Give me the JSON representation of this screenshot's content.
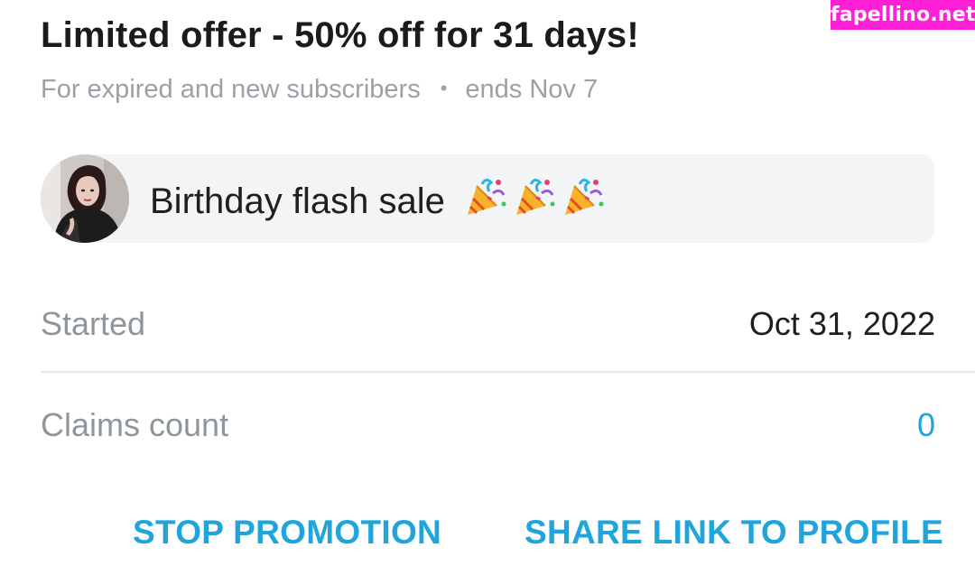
{
  "watermark": {
    "text": "fapellino.net"
  },
  "promotion": {
    "title": "Limited offer - 50% off for 31 days!",
    "audience": "For expired and new subscribers",
    "separator": "•",
    "ends": "ends Nov 7",
    "message": "Birthday flash sale",
    "message_icons": [
      "party-popper-icon",
      "party-popper-icon",
      "party-popper-icon"
    ]
  },
  "details": {
    "started_label": "Started",
    "started_value": "Oct 31, 2022",
    "claims_label": "Claims count",
    "claims_value": "0"
  },
  "actions": {
    "stop_label": "STOP PROMOTION",
    "share_label": "SHARE LINK TO PROFILE"
  },
  "colors": {
    "accent": "#1fa5dc",
    "watermark_bg": "#ff1fd6",
    "muted_text": "#8f969b",
    "bubble_bg": "#f2f4f5"
  }
}
